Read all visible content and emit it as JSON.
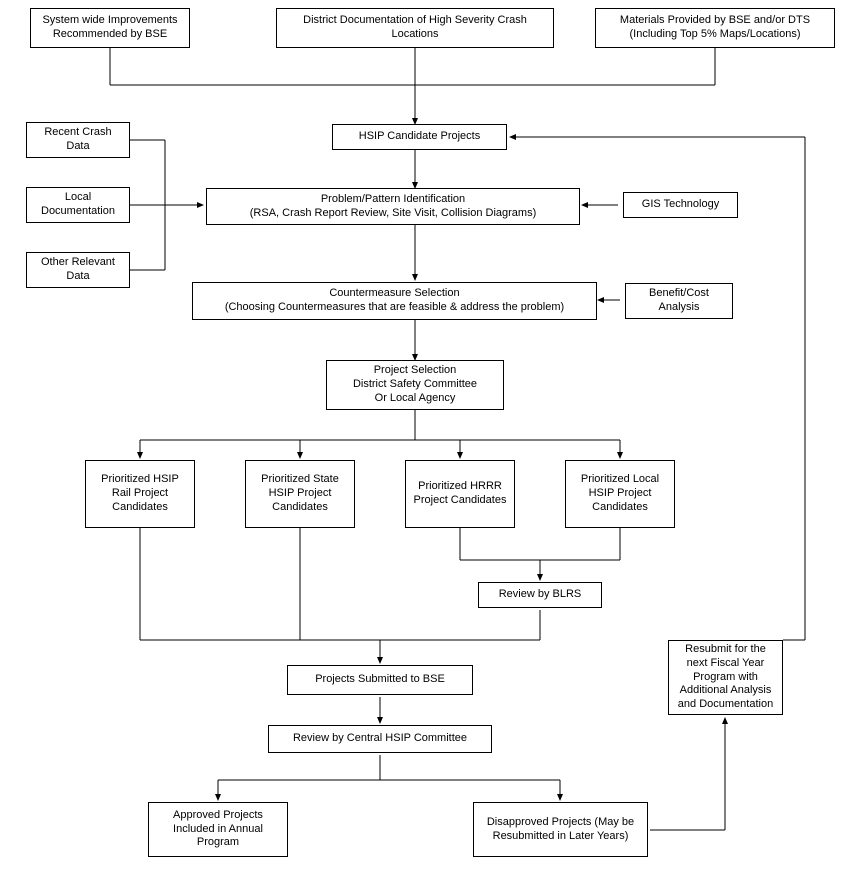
{
  "top1": "System wide Improvements Recommended by BSE",
  "top2": "District Documentation of High Severity Crash Locations",
  "top3": "Materials Provided by BSE and/or DTS (Including Top 5% Maps/Locations)",
  "side_recent": "Recent Crash Data",
  "side_local": "Local Documentation",
  "side_other": "Other Relevant Data",
  "hsip_candidate": "HSIP Candidate Projects",
  "problem": "Problem/Pattern Identification\n(RSA, Crash Report Review, Site Visit, Collision Diagrams)",
  "gis": "GIS Technology",
  "counter": "Countermeasure Selection\n(Choosing Countermeasures that are feasible & address the problem)",
  "benefit": "Benefit/Cost Analysis",
  "project_sel": "Project Selection\nDistrict Safety Committee\nOr Local Agency",
  "p_rail": "Prioritized HSIP Rail Project Candidates",
  "p_state": "Prioritized State HSIP Project Candidates",
  "p_hrrr": "Prioritized HRRR Project Candidates",
  "p_local": "Prioritized Local HSIP Project Candidates",
  "review_blrs": "Review by BLRS",
  "proj_bse": "Projects Submitted to BSE",
  "resubmit": "Resubmit for the next Fiscal Year Program with Additional Analysis and Documentation",
  "review_central": "Review by Central HSIP Committee",
  "approved": "Approved Projects Included in Annual Program",
  "disapproved": "Disapproved Projects (May be Resubmitted in Later Years)"
}
